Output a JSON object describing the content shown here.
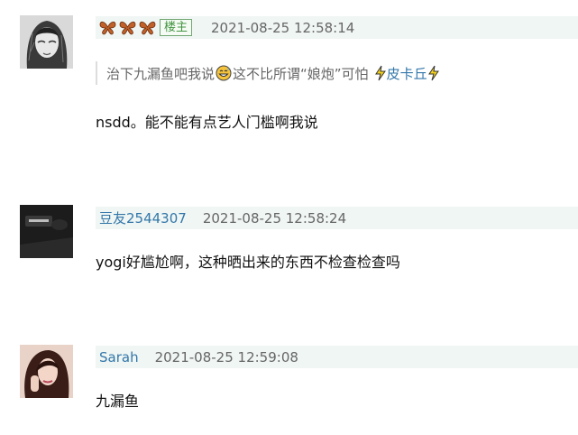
{
  "comments": [
    {
      "avatar_icon": "sketch-portrait-avatar",
      "badge": "楼主",
      "time": "2021-08-25 12:58:14",
      "quote": {
        "text_before": "治下九漏鱼吧我说",
        "emoji": "grinning-sweat-emoji",
        "text_after": "这不比所谓“娘炮”可怕",
        "author": "皮卡丘"
      },
      "text": "nsdd。能不能有点艺人门槛啊我说"
    },
    {
      "avatar_icon": "dark-photo-avatar",
      "author": "豆友2544307",
      "time": "2021-08-25 12:58:24",
      "text": "yogi好尴尬啊，这种晒出来的东西不检查检查吗"
    },
    {
      "avatar_icon": "woman-photo-avatar",
      "author": "Sarah",
      "time": "2021-08-25 12:59:08",
      "text": "九漏鱼"
    }
  ],
  "colors": {
    "author_link": "#3377aa",
    "meta_bg": "#f0f6f3",
    "owner_badge": "#42953f",
    "butterfly": "#c0612a"
  }
}
